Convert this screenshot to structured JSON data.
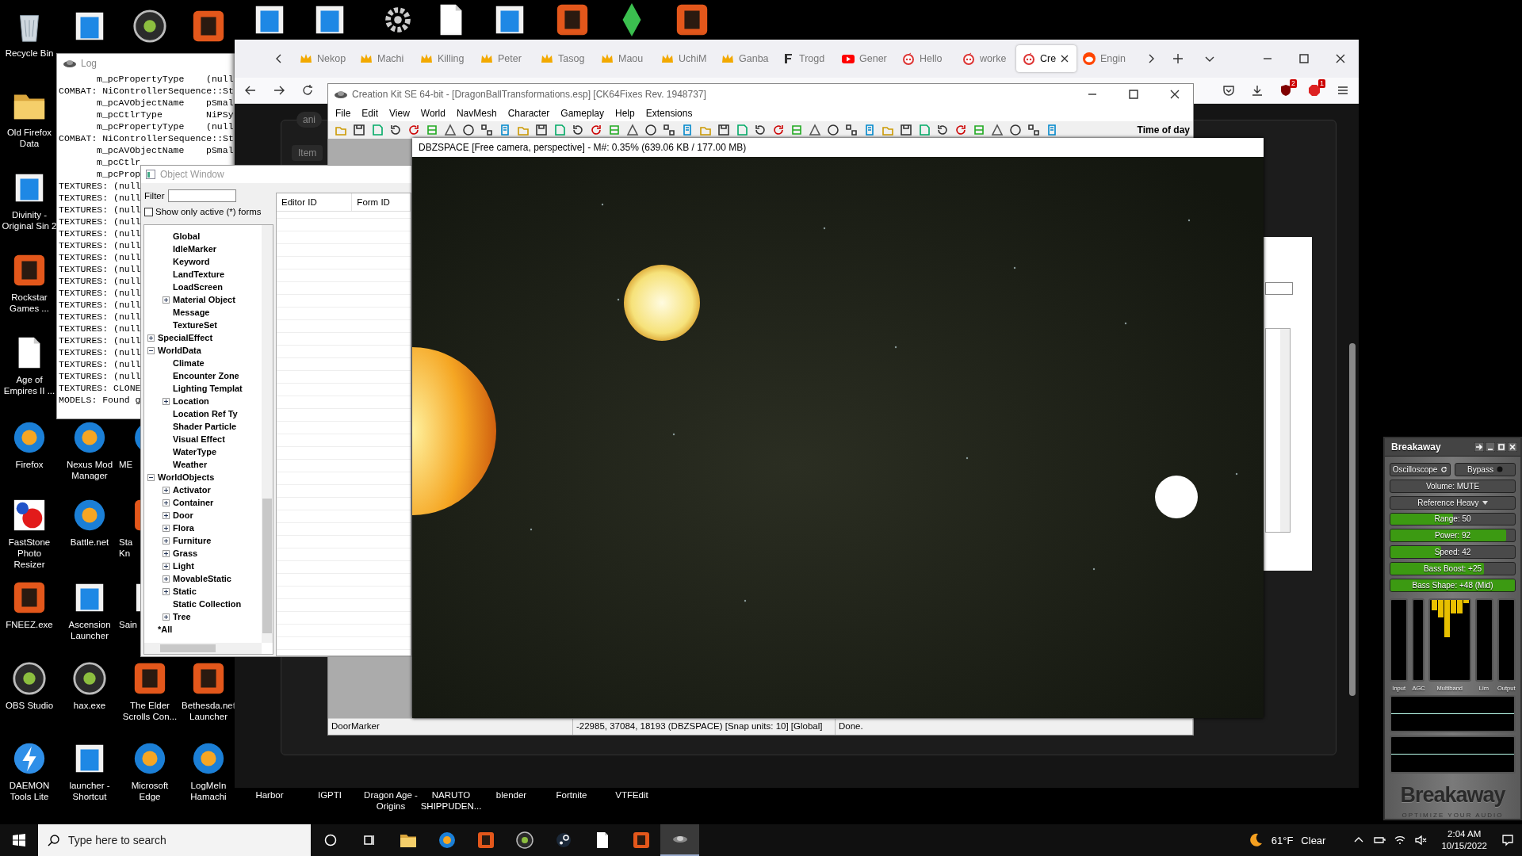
{
  "desktop_icons": [
    {
      "kind": "bin",
      "label": "Recycle Bin"
    },
    {
      "kind": "folder",
      "label": "Old Firefox Data"
    },
    {
      "kind": "window",
      "label": "Divinity - Original Sin 2"
    },
    {
      "kind": "tile",
      "label": "Rockstar Games ..."
    },
    {
      "kind": "page",
      "label": "Age of Empires II ..."
    },
    {
      "kind": "orb",
      "label": "Firefox"
    },
    {
      "kind": "flower",
      "label": "FastStone Photo Resizer"
    },
    {
      "kind": "tile",
      "label": "FNEEZ.exe"
    },
    {
      "kind": "disc",
      "label": "OBS Studio"
    },
    {
      "kind": "bolt",
      "label": "DAEMON Tools Lite"
    },
    {
      "kind": "window"
    },
    {
      "kind": "orb",
      "label": "Nexus Mod Manager"
    },
    {
      "kind": "orb",
      "label": "Battle.net"
    },
    {
      "kind": "window",
      "label": "Ascension Launcher"
    },
    {
      "kind": "disc",
      "label": "hax.exe"
    },
    {
      "kind": "window",
      "label": "launcher - Shortcut"
    },
    {
      "kind": "disc"
    },
    {
      "kind": "orb",
      "label": "ME"
    },
    {
      "kind": "tile",
      "label": "Sta Kn"
    },
    {
      "kind": "window",
      "label": "Sain"
    },
    {
      "kind": "tile",
      "label": "The Elder Scrolls Con..."
    },
    {
      "kind": "orb",
      "label": "Microsoft Edge"
    },
    {
      "kind": "tile"
    },
    {
      "kind": "tile",
      "label": "Bethesda.net Launcher"
    },
    {
      "kind": "orb",
      "label": "LogMeIn Hamachi"
    },
    {
      "kind": "window"
    },
    {
      "kind": "window"
    },
    {
      "kind": "gear"
    },
    {
      "kind": "page"
    },
    {
      "kind": "window"
    },
    {
      "kind": "tile"
    },
    {
      "kind": "gem"
    },
    {
      "kind": "tile"
    },
    {
      "label": "Harbor"
    },
    {
      "label": "IGPTI"
    },
    {
      "label": "Dragon Age - Origins"
    },
    {
      "label": "NARUTO SHIPPUDEN..."
    },
    {
      "label": "blender"
    },
    {
      "label": "Fortnite"
    },
    {
      "label": "VTFEdit"
    }
  ],
  "log_window": {
    "title": "Log",
    "lines": [
      {
        "text": "m_pcPropertyType    (null",
        "indent": true
      },
      {
        "text": "COMBAT: NiControllerSequence::St",
        "indent": false
      },
      {
        "text": "m_pcAVObjectName    pSmal",
        "indent": true
      },
      {
        "text": "m_pcCtlrType        NiPSy",
        "indent": true
      },
      {
        "text": "m_pcPropertyType    (null",
        "indent": true
      },
      {
        "text": "COMBAT: NiControllerSequence::St",
        "indent": false
      },
      {
        "text": "m_pcAVObjectName    pSmal",
        "indent": true
      },
      {
        "text": "m_pcCtlr",
        "indent": true
      },
      {
        "text": "m_pcProp",
        "indent": true
      },
      {
        "text": "TEXTURES: (null",
        "indent": false
      },
      {
        "text": "TEXTURES: (null",
        "indent": false
      },
      {
        "text": "TEXTURES: (null",
        "indent": false
      },
      {
        "text": "TEXTURES: (null",
        "indent": false
      },
      {
        "text": "TEXTURES: (null",
        "indent": false
      },
      {
        "text": "TEXTURES: (null",
        "indent": false
      },
      {
        "text": "TEXTURES: (null",
        "indent": false
      },
      {
        "text": "TEXTURES: (null",
        "indent": false
      },
      {
        "text": "TEXTURES: (null",
        "indent": false
      },
      {
        "text": "TEXTURES: (null",
        "indent": false
      },
      {
        "text": "TEXTURES: (null",
        "indent": false
      },
      {
        "text": "TEXTURES: (null",
        "indent": false
      },
      {
        "text": "TEXTURES: (null",
        "indent": false
      },
      {
        "text": "TEXTURES: (null",
        "indent": false
      },
      {
        "text": "TEXTURES: (null",
        "indent": false
      },
      {
        "text": "TEXTURES: (null",
        "indent": false
      },
      {
        "text": "TEXTURES: (null",
        "indent": false
      },
      {
        "text": "TEXTURES: CLONE",
        "indent": false
      },
      {
        "text": "MODELS: Found g",
        "indent": false
      }
    ]
  },
  "browser": {
    "tabs": [
      {
        "label": "Nekop",
        "kind": "crown",
        "selected": false
      },
      {
        "label": "Machi",
        "kind": "crown",
        "selected": false
      },
      {
        "label": "Killing",
        "kind": "crown",
        "selected": false
      },
      {
        "label": "Peter",
        "kind": "crown",
        "selected": false
      },
      {
        "label": "Tasog",
        "kind": "crown",
        "selected": false
      },
      {
        "label": "Maou",
        "kind": "crown",
        "selected": false
      },
      {
        "label": "UchiM",
        "kind": "crown",
        "selected": false
      },
      {
        "label": "Ganba",
        "kind": "crown",
        "selected": false
      },
      {
        "label": "Trogd",
        "kind": "mark",
        "selected": false
      },
      {
        "label": "Gener",
        "kind": "play",
        "selected": false
      },
      {
        "label": "Hello",
        "kind": "mascot",
        "selected": false
      },
      {
        "label": "worke",
        "kind": "mascot",
        "selected": false
      },
      {
        "label": "Cre",
        "kind": "mascot",
        "selected": true
      },
      {
        "label": "Engin",
        "kind": "logo",
        "selected": false
      }
    ],
    "toolbar_badges": [
      "2",
      "1"
    ],
    "page_chips": [
      "ani",
      "Item"
    ]
  },
  "creation_kit": {
    "title": "Creation Kit SE 64-bit - [DragonBallTransformations.esp] [CK64Fixes Rev. 1948737]",
    "menu": [
      "File",
      "Edit",
      "View",
      "World",
      "NavMesh",
      "Character",
      "Gameplay",
      "Help",
      "Extensions"
    ],
    "toolbar_label": "Time of day",
    "status_bar": [
      "DoorMarker",
      "-22985, 37084, 18193 (DBZSPACE) [Snap units: 10] [Global]",
      "Done."
    ]
  },
  "object_window": {
    "title": "Object Window",
    "filter_label": "Filter",
    "show_only_active": {
      "label": "Show only active (*) forms",
      "checked": false
    },
    "columns": [
      "Editor ID",
      "Form ID"
    ],
    "tree": [
      {
        "children": [
          {
            "label": "Global"
          },
          {
            "label": "IdleMarker"
          },
          {
            "label": "Keyword"
          },
          {
            "label": "LandTexture"
          },
          {
            "label": "LoadScreen"
          },
          {
            "label": "Material Object",
            "expanded": false
          },
          {
            "label": "Message"
          },
          {
            "label": "TextureSet"
          }
        ]
      },
      {
        "label": "SpecialEffect",
        "expanded": false
      },
      {
        "label": "WorldData",
        "expanded": true,
        "children": [
          {
            "label": "Climate"
          },
          {
            "label": "Encounter Zone"
          },
          {
            "label": "Lighting Templat"
          },
          {
            "label": "Location",
            "expanded": false
          },
          {
            "label": "Location Ref Ty"
          },
          {
            "label": "Shader Particle"
          },
          {
            "label": "Visual Effect"
          },
          {
            "label": "WaterType"
          },
          {
            "label": "Weather"
          }
        ]
      },
      {
        "label": "WorldObjects",
        "expanded": true,
        "children": [
          {
            "label": "Activator",
            "expanded": false
          },
          {
            "label": "Container",
            "expanded": false
          },
          {
            "label": "Door",
            "expanded": false
          },
          {
            "label": "Flora",
            "expanded": false
          },
          {
            "label": "Furniture",
            "expanded": false
          },
          {
            "label": "Grass",
            "expanded": false
          },
          {
            "label": "Light",
            "expanded": false
          },
          {
            "label": "MovableStatic",
            "expanded": false
          },
          {
            "label": "Static",
            "expanded": false
          },
          {
            "label": "Static Collection"
          },
          {
            "label": "Tree",
            "expanded": false
          }
        ]
      },
      {
        "label": "*All"
      }
    ]
  },
  "render_window": {
    "title": "DBZSPACE [Free camera, perspective] - M#: 0.35% (639.06 KB / 177.00 MB)"
  },
  "breakaway": {
    "title": "Breakaway",
    "mode": "Oscilloscope",
    "bypass": "Bypass",
    "volume": "Volume: MUTE",
    "preset": "Reference Heavy",
    "sliders": [
      {
        "label": "Range: 50",
        "level": 0.5
      },
      {
        "label": "Power: 92",
        "level": 0.93
      },
      {
        "label": "Speed: 42",
        "level": 0.41
      },
      {
        "label": "Bass Boost: +25",
        "level": 0.75
      },
      {
        "label": "Bass Shape: +48 (Mid)",
        "level": 1
      }
    ],
    "meters": [
      "Input",
      "AGC",
      "Multiband",
      "Lim",
      "Output"
    ],
    "logo": "Breakaway",
    "tagline": "OPTIMIZE YOUR AUDIO"
  },
  "taskbar": {
    "search_placeholder": "Type here to search",
    "apps": [
      {
        "kind": "ring",
        "selected": false
      },
      {
        "kind": "taskview",
        "selected": false
      },
      {
        "kind": "folder",
        "selected": false
      },
      {
        "kind": "orb",
        "selected": false
      },
      {
        "kind": "tile",
        "selected": false
      },
      {
        "kind": "disc",
        "selected": false
      },
      {
        "kind": "steam",
        "selected": false
      },
      {
        "kind": "page",
        "selected": false
      },
      {
        "kind": "tile",
        "selected": false
      },
      {
        "kind": "ck",
        "selected": true
      }
    ],
    "weather_temperature": "61°F",
    "weather_condition": "Clear",
    "time": "2:04 AM",
    "date": "10/15/2022"
  }
}
